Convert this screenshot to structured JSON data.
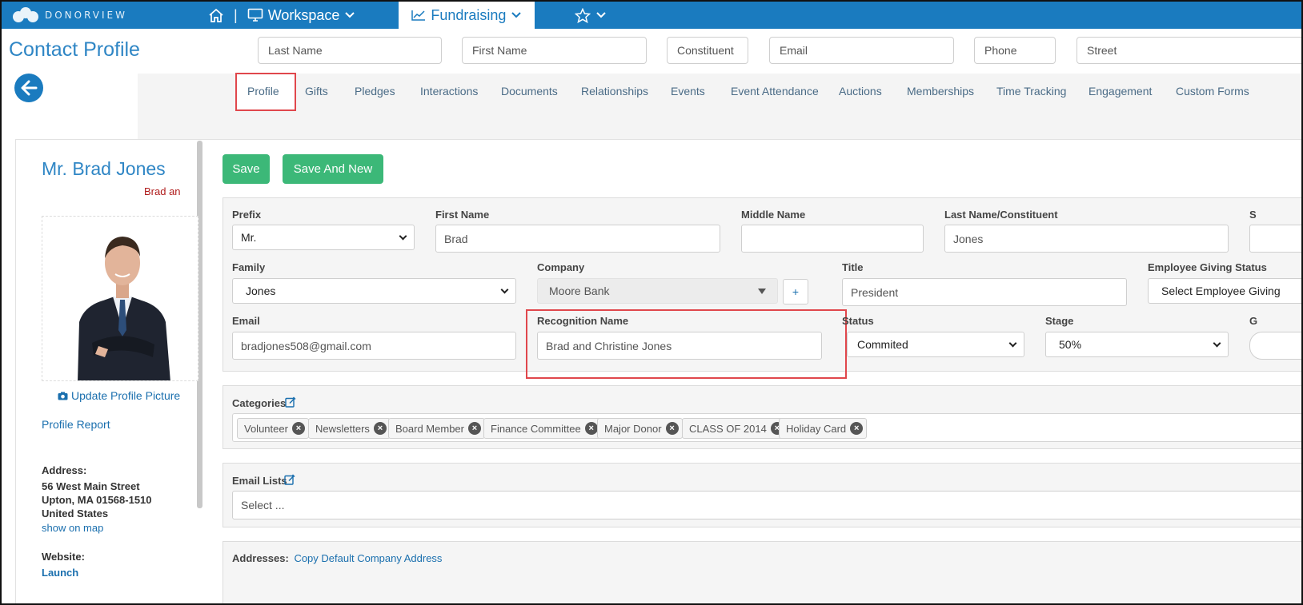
{
  "brand": {
    "name": "DONORVIEW"
  },
  "topnav": {
    "workspace": "Workspace",
    "fundraising": "Fundraising",
    "separator": "|"
  },
  "header": {
    "title": "Contact Profile",
    "search_fields": [
      {
        "placeholder": "Last Name"
      },
      {
        "placeholder": "First Name"
      },
      {
        "placeholder": "Constituent ID"
      },
      {
        "placeholder": "Email"
      },
      {
        "placeholder": "Phone"
      },
      {
        "placeholder": "Street"
      }
    ]
  },
  "tabs": [
    "Profile",
    "Gifts",
    "Pledges",
    "Interactions",
    "Documents",
    "Relationships",
    "Events",
    "Event Attendance",
    "Auctions",
    "Memberships",
    "Time Tracking",
    "Engagement",
    "Custom Forms"
  ],
  "sidebar": {
    "name": "Mr. Brad Jones",
    "subtitle": "Brad an",
    "update_picture": "Update Profile Picture",
    "profile_report": "Profile Report",
    "address_label": "Address:",
    "address_lines": [
      "56 West Main Street",
      "Upton, MA 01568-1510",
      "United States"
    ],
    "show_on_map": "show on map",
    "website_label": "Website:",
    "website_link": "Launch"
  },
  "actions": {
    "save": "Save",
    "save_and_new": "Save And New"
  },
  "form": {
    "prefix": {
      "label": "Prefix",
      "value": "Mr."
    },
    "first_name": {
      "label": "First Name",
      "value": "Brad"
    },
    "middle_name": {
      "label": "Middle Name",
      "value": ""
    },
    "last_name": {
      "label": "Last Name/Constituent",
      "value": "Jones"
    },
    "cut_label": "S",
    "family": {
      "label": "Family",
      "value": "Jones"
    },
    "company": {
      "label": "Company",
      "value": "Moore Bank",
      "add": "+"
    },
    "title": {
      "label": "Title",
      "value": "President"
    },
    "employee_giving": {
      "label": "Employee Giving Status",
      "value": "Select Employee Giving"
    },
    "email": {
      "label": "Email",
      "value": "bradjones508@gmail.com"
    },
    "recognition_name": {
      "label": "Recognition Name",
      "value": "Brad and Christine Jones"
    },
    "status": {
      "label": "Status",
      "value": "Commited"
    },
    "stage": {
      "label": "Stage",
      "value": "50%"
    },
    "cut_label2": "G"
  },
  "categories": {
    "label": "Categories",
    "tags": [
      "Volunteer",
      "Newsletters",
      "Board Member",
      "Finance Committee",
      "Major Donor",
      "CLASS OF 2014",
      "Holiday Card"
    ]
  },
  "email_lists": {
    "label": "Email Lists",
    "placeholder": "Select ..."
  },
  "addresses": {
    "label": "Addresses:",
    "link": "Copy Default Company Address"
  },
  "colors": {
    "brand_blue": "#1a7bbf",
    "green": "#3cb878",
    "highlight": "#e0474c"
  }
}
